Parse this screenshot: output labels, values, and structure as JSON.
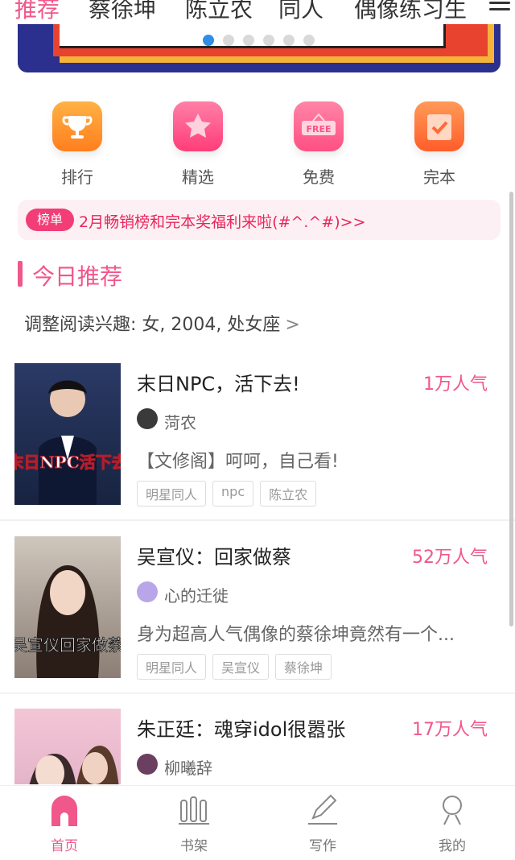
{
  "top_tabs": [
    "推荐",
    "蔡徐坤",
    "陈立农",
    "同人",
    "偶像练习生"
  ],
  "banner": {
    "dots": 6,
    "active_dot": 0
  },
  "categories": [
    {
      "label": "排行",
      "icon": "trophy-icon"
    },
    {
      "label": "精选",
      "icon": "star-icon"
    },
    {
      "label": "免费",
      "icon": "free-sign-icon",
      "icon_text": "FREE"
    },
    {
      "label": "完本",
      "icon": "check-doc-icon"
    }
  ],
  "notice": {
    "badge": "榜单",
    "text": "2月畅销榜和完本奖福利来啦(#^.^#)>>"
  },
  "section": {
    "title": "今日推荐",
    "interest": "调整阅读兴趣: 女, 2004, 处女座",
    "interest_chevron": ">"
  },
  "books": [
    {
      "title": "末日NPC，活下去!",
      "popularity": "1万人气",
      "author": "菏农",
      "desc": "【文修阁】呵呵，自己看!",
      "tags": [
        "明星同人",
        "npc",
        "陈立农"
      ],
      "cover_text": "末日NPC活下去"
    },
    {
      "title": "吴宣仪：回家做蔡",
      "popularity": "52万人气",
      "author": "心的迁徙",
      "desc": "身为超高人气偶像的蔡徐坤竟然有一个...",
      "tags": [
        "明星同人",
        "吴宣仪",
        "蔡徐坤"
      ],
      "cover_text": "吴宣仪回家做蔡"
    },
    {
      "title": "朱正廷：魂穿idol很嚣张",
      "popularity": "17万人气",
      "author": "柳曦辞",
      "desc": "",
      "tags": [],
      "cover_text": ""
    }
  ],
  "bottom_nav": [
    {
      "label": "首页",
      "icon": "home-icon",
      "active": true
    },
    {
      "label": "书架",
      "icon": "bookshelf-icon",
      "active": false
    },
    {
      "label": "写作",
      "icon": "pencil-icon",
      "active": false
    },
    {
      "label": "我的",
      "icon": "profile-icon",
      "active": false
    }
  ],
  "colors": {
    "accent": "#f0578a",
    "notice_text": "#e9265c"
  }
}
